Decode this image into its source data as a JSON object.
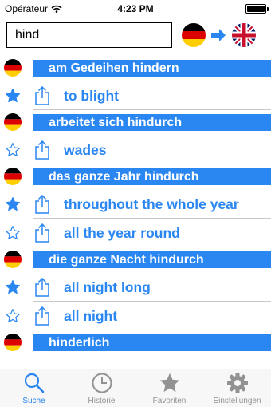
{
  "status_bar": {
    "carrier": "Opérateur",
    "time": "4:23 PM",
    "battery_percent": 100
  },
  "search": {
    "query": "hind"
  },
  "colors": {
    "accent": "#2a86f0",
    "star": "#2a86f0",
    "tab_inactive": "#929292"
  },
  "results": [
    {
      "de": "am Gedeihen hindern",
      "en": [
        {
          "text": "to blight",
          "favorite": true
        }
      ]
    },
    {
      "de": "arbeitet sich hindurch",
      "en": [
        {
          "text": "wades",
          "favorite": false
        }
      ]
    },
    {
      "de": "das ganze Jahr hindurch",
      "en": [
        {
          "text": "throughout the whole year",
          "favorite": true
        },
        {
          "text": "all the year round",
          "favorite": false
        }
      ]
    },
    {
      "de": "die ganze Nacht hindurch",
      "en": [
        {
          "text": "all night long",
          "favorite": true
        },
        {
          "text": "all night",
          "favorite": false
        }
      ]
    },
    {
      "de": "hinderlich",
      "en": []
    }
  ],
  "tabs": [
    {
      "label": "Suche",
      "icon": "magnifier-icon",
      "active": true
    },
    {
      "label": "Historie",
      "icon": "clock-icon",
      "active": false
    },
    {
      "label": "Favoriten",
      "icon": "star-icon",
      "active": false
    },
    {
      "label": "Einstellungen",
      "icon": "gear-icon",
      "active": false
    }
  ]
}
